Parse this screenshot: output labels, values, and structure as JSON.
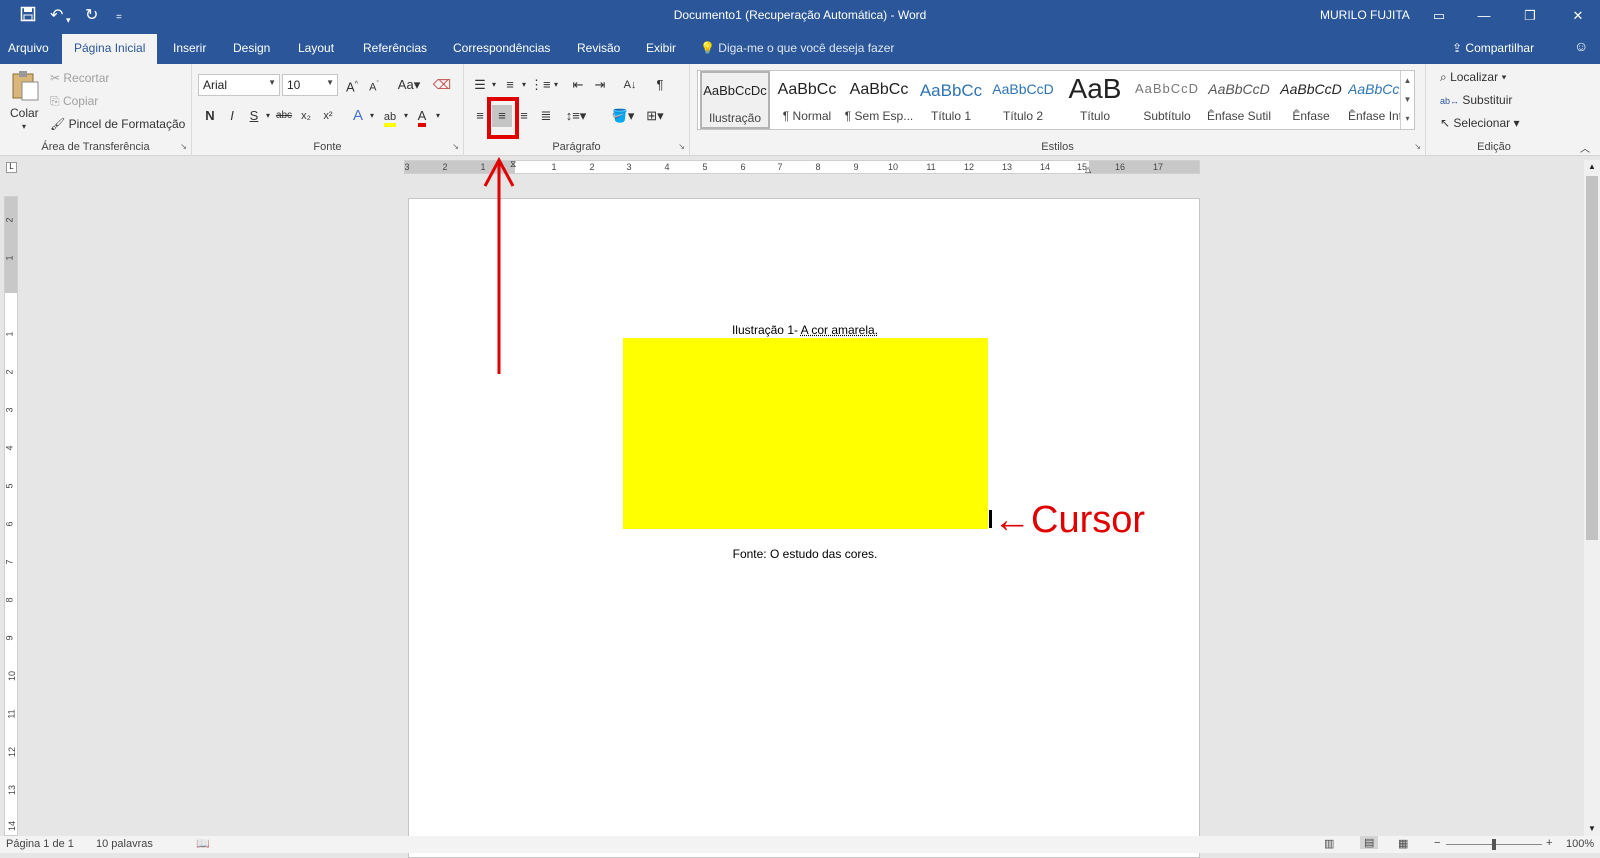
{
  "window": {
    "title": "Documento1 (Recuperação Automática)  -  Word",
    "user": "MURILO FUJITA"
  },
  "tabs": [
    "Arquivo",
    "Página Inicial",
    "Inserir",
    "Design",
    "Layout",
    "Referências",
    "Correspondências",
    "Revisão",
    "Exibir"
  ],
  "tell_me": "Diga-me o que você deseja fazer",
  "share": "Compartilhar",
  "clipboard": {
    "paste": "Colar",
    "cut": "Recortar",
    "copy": "Copiar",
    "format_painter": "Pincel de Formatação",
    "label": "Área de Transferência"
  },
  "font": {
    "name": "Arial",
    "size": "10",
    "grow": "A",
    "shrink": "A",
    "case": "Aa",
    "bold": "N",
    "italic": "I",
    "underline": "S",
    "strike": "abc",
    "subscript": "x₂",
    "superscript": "x²",
    "label": "Fonte"
  },
  "paragraph": {
    "label": "Parágrafo",
    "pilcrow": "¶"
  },
  "styles": {
    "label": "Estilos",
    "items": [
      {
        "preview": "AaBbCcDc",
        "name": "Ilustração"
      },
      {
        "preview": "AaBbCc",
        "name": "¶ Normal"
      },
      {
        "preview": "AaBbCc",
        "name": "¶ Sem Esp..."
      },
      {
        "preview": "AaBbCc",
        "name": "Título 1"
      },
      {
        "preview": "AaBbCcD",
        "name": "Título 2"
      },
      {
        "preview": "AaB",
        "name": "Título"
      },
      {
        "preview": "AaBbCcD",
        "name": "Subtítulo"
      },
      {
        "preview": "AaBbCcD",
        "name": "Ênfase Sutil"
      },
      {
        "preview": "AaBbCcD",
        "name": "Ênfase"
      },
      {
        "preview": "AaBbCcD",
        "name": "Ênfase Int..."
      }
    ]
  },
  "editing": {
    "find": "Localizar",
    "replace": "Substituir",
    "select": "Selecionar",
    "label": "Edição"
  },
  "ruler_h_ticks": [
    "3",
    "2",
    "1",
    "1",
    "2",
    "3",
    "4",
    "5",
    "6",
    "7",
    "8",
    "9",
    "10",
    "11",
    "12",
    "13",
    "14",
    "15",
    "16",
    "17"
  ],
  "ruler_v_ticks": [
    "2",
    "1",
    "1",
    "2",
    "3",
    "4",
    "5",
    "6",
    "7",
    "8",
    "9",
    "10",
    "11",
    "12",
    "13",
    "14"
  ],
  "document": {
    "caption_prefix": "Ilustração 1-",
    "caption_rest": "A cor amarela.",
    "image_color": "#ffff00",
    "source": "Fonte: O estudo das cores."
  },
  "annotation": {
    "cursor_label": "←Cursor",
    "color": "#e00000"
  },
  "status": {
    "page": "Página 1 de 1",
    "words": "10 palavras",
    "zoom": "100%"
  }
}
